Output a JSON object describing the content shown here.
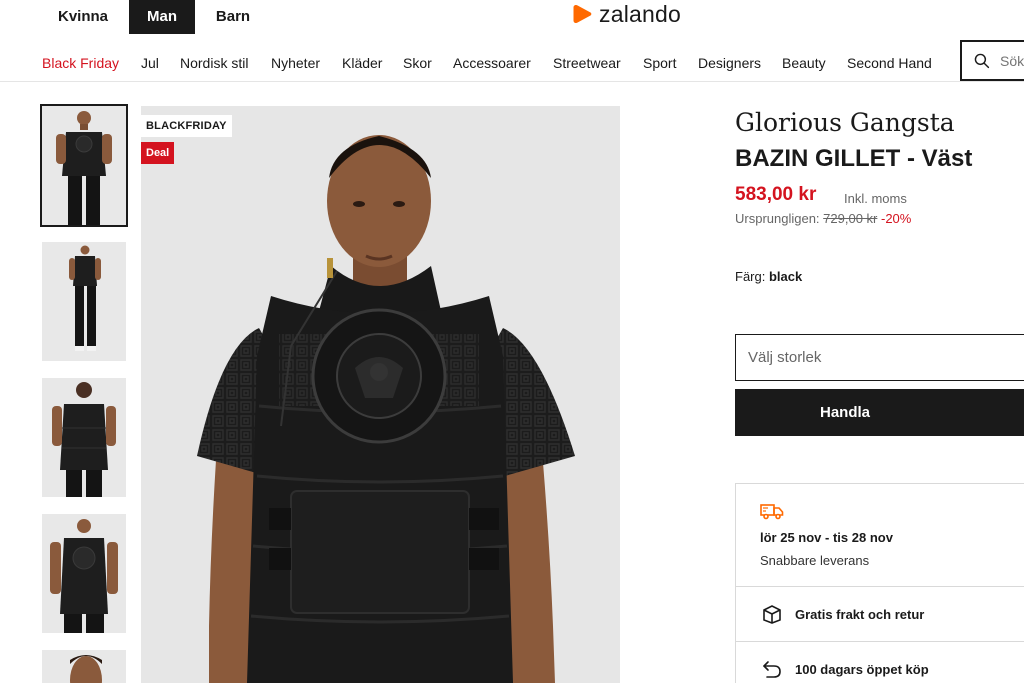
{
  "header": {
    "gender_tabs": [
      "Kvinna",
      "Man",
      "Barn"
    ],
    "active_gender": "Man",
    "logo_text": "zalando",
    "brand_color": "#ff6900"
  },
  "nav": {
    "categories": [
      "Black Friday",
      "Jul",
      "Nordisk stil",
      "Nyheter",
      "Kläder",
      "Skor",
      "Accessoarer",
      "Streetwear",
      "Sport",
      "Designers",
      "Beauty",
      "Second Hand"
    ],
    "sale_color": "#d4131f",
    "search_placeholder": "Sök"
  },
  "gallery": {
    "thumbnail_count": 5,
    "selected_index": 0,
    "flags": {
      "promo": "BLACKFRIDAY",
      "deal": "Deal"
    },
    "print_text": "GLORIOUS GANGSTA"
  },
  "product": {
    "brand": "Glorious Gangsta",
    "name": "BAZIN GILLET - Väst",
    "price": "583,00 kr",
    "vat_note": "Inkl. moms",
    "original_label": "Ursprungligen:",
    "original_price": "729,00 kr",
    "discount": "-20%",
    "color_label": "Färg:",
    "color_value": "black",
    "size_placeholder": "Välj storlek",
    "buy_label": "Handla"
  },
  "delivery": {
    "dates": "lör 25 nov - tis 28 nov",
    "speed": "Snabbare leverans",
    "free_shipping": "Gratis frakt och retur",
    "open_purchase": "100 dagars öppet köp",
    "accent_color": "#ff6900"
  }
}
